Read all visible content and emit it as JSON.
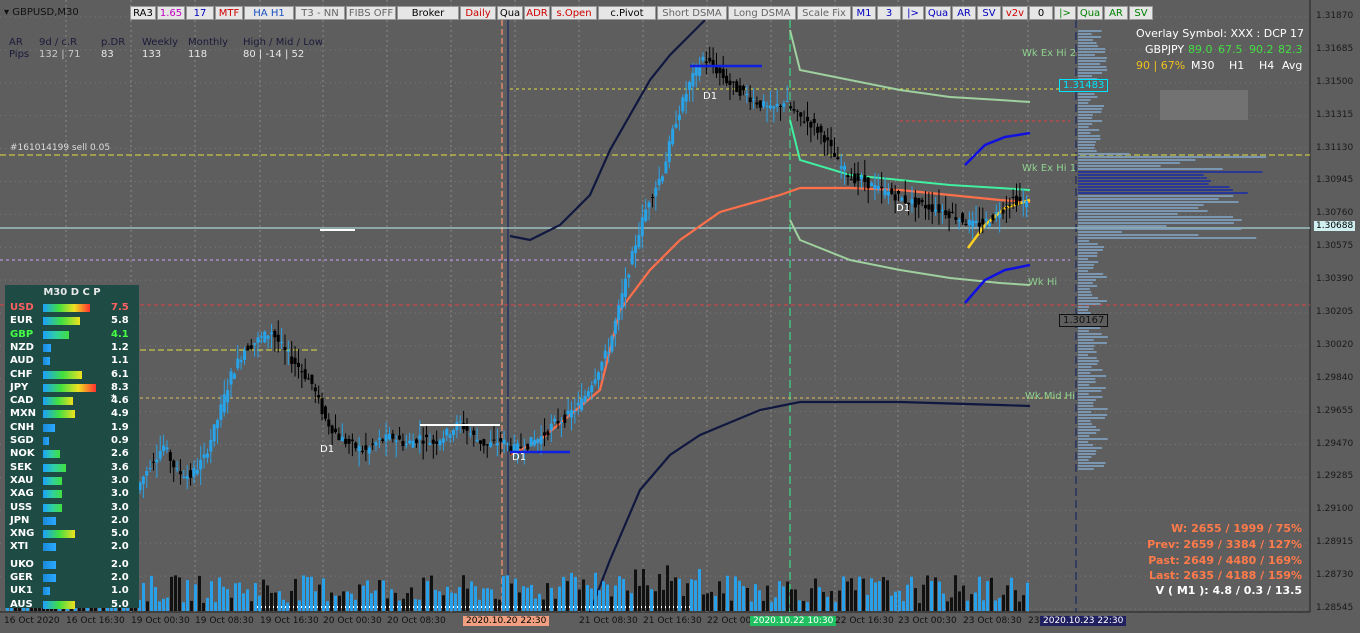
{
  "window": {
    "title": "GBPUSD,M30"
  },
  "toolbar": [
    {
      "label": "RA3",
      "color": "#000000"
    },
    {
      "label": "1.65",
      "color": "#c000c0"
    },
    {
      "label": "17",
      "color": "#0000c0"
    },
    {
      "label": "MTF",
      "color": "#d00000"
    },
    {
      "label": "HA H1",
      "color": "#1a50c0"
    },
    {
      "label": "T3 - NN",
      "color": "#666666"
    },
    {
      "label": "FIBS OFF",
      "color": "#666666"
    },
    {
      "label": "Broker",
      "color": "#000000"
    },
    {
      "label": "Daily",
      "color": "#d00000"
    },
    {
      "label": "Qua",
      "color": "#000000"
    },
    {
      "label": "ADR",
      "color": "#d00000"
    },
    {
      "label": "s.Open",
      "color": "#d00000"
    },
    {
      "label": "c.Pivot",
      "color": "#000000"
    },
    {
      "label": "Short DSMA",
      "color": "#666666"
    },
    {
      "label": "Long DSMA",
      "color": "#666666"
    },
    {
      "label": "Scale Fix",
      "color": "#666666"
    },
    {
      "label": "M1",
      "color": "#0000c0"
    },
    {
      "label": "3",
      "color": "#0000c0"
    },
    {
      "label": "|>",
      "color": "#0000c0"
    },
    {
      "label": "Qua",
      "color": "#0000c0"
    },
    {
      "label": "AR",
      "color": "#0000c0"
    },
    {
      "label": "SV",
      "color": "#0000c0"
    },
    {
      "label": "v2v",
      "color": "#d00000"
    },
    {
      "label": "0",
      "color": "#000000"
    },
    {
      "label": "|>",
      "color": "#008000"
    },
    {
      "label": "Qua",
      "color": "#008000"
    },
    {
      "label": "AR",
      "color": "#008000"
    },
    {
      "label": "SV",
      "color": "#008000"
    }
  ],
  "range_stats": {
    "headers": [
      "AR",
      "9d / c.R",
      "p.DR",
      "Weekly",
      "Monthly",
      "High / Mid / Low"
    ],
    "row_label": "Pips",
    "c_r_value": "132 | 71",
    "p_dr": "83",
    "weekly": "133",
    "monthly": "118",
    "hml": "80  |  -14  |  52"
  },
  "order_label": "#161014199 sell 0.05",
  "currency_panel": {
    "title": "M30   D C P",
    "rows": [
      {
        "name": "USD",
        "value": "7.5",
        "name_color": "#ff6060",
        "value_color": "#ff6060",
        "fill": 0.78,
        "bar": "redhot"
      },
      {
        "name": "EUR",
        "value": "5.8",
        "name_color": "#ffffff",
        "value_color": "#ffffff",
        "fill": 0.62,
        "bar": "warm"
      },
      {
        "name": "GBP",
        "value": "4.1",
        "name_color": "#44ff44",
        "value_color": "#44ff44",
        "fill": 0.44,
        "bar": "cool"
      },
      {
        "name": "NZD",
        "value": "1.2",
        "name_color": "#ffffff",
        "value_color": "#ffffff",
        "fill": 0.13,
        "bar": "blue"
      },
      {
        "name": "AUD",
        "value": "1.1",
        "name_color": "#ffffff",
        "value_color": "#ffffff",
        "fill": 0.12,
        "bar": "blue"
      },
      {
        "name": "CHF",
        "value": "6.1",
        "name_color": "#ffffff",
        "value_color": "#ffffff",
        "fill": 0.65,
        "bar": "warm"
      },
      {
        "name": "JPY",
        "value": "8.3 *",
        "name_color": "#ffffff",
        "value_color": "#ffffff",
        "fill": 0.88,
        "bar": "redhot"
      },
      {
        "name": "CAD",
        "value": "4.6",
        "name_color": "#ffffff",
        "value_color": "#ffffff",
        "fill": 0.5,
        "bar": "warm"
      },
      {
        "name": "MXN",
        "value": "4.9",
        "name_color": "#ffffff",
        "value_color": "#ffffff",
        "fill": 0.53,
        "bar": "warm"
      },
      {
        "name": "CNH",
        "value": "1.9",
        "name_color": "#ffffff",
        "value_color": "#ffffff",
        "fill": 0.2,
        "bar": "blue"
      },
      {
        "name": "SGD",
        "value": "0.9",
        "name_color": "#ffffff",
        "value_color": "#ffffff",
        "fill": 0.1,
        "bar": "blue"
      },
      {
        "name": "NOK",
        "value": "2.6",
        "name_color": "#ffffff",
        "value_color": "#ffffff",
        "fill": 0.28,
        "bar": "cool"
      },
      {
        "name": "SEK",
        "value": "3.6",
        "name_color": "#ffffff",
        "value_color": "#ffffff",
        "fill": 0.38,
        "bar": "cool"
      },
      {
        "name": "XAU",
        "value": "3.0",
        "name_color": "#ffffff",
        "value_color": "#ffffff",
        "fill": 0.32,
        "bar": "cool"
      },
      {
        "name": "XAG",
        "value": "3.0",
        "name_color": "#ffffff",
        "value_color": "#ffffff",
        "fill": 0.32,
        "bar": "cool"
      },
      {
        "name": "USS",
        "value": "3.0",
        "name_color": "#ffffff",
        "value_color": "#ffffff",
        "fill": 0.32,
        "bar": "cool"
      },
      {
        "name": "JPN",
        "value": "2.0",
        "name_color": "#ffffff",
        "value_color": "#ffffff",
        "fill": 0.21,
        "bar": "blue"
      },
      {
        "name": "XNG",
        "value": "5.0",
        "name_color": "#ffffff",
        "value_color": "#ffffff",
        "fill": 0.54,
        "bar": "warm"
      },
      {
        "name": "XTI",
        "value": "2.0",
        "name_color": "#ffffff",
        "value_color": "#ffffff",
        "fill": 0.21,
        "bar": "blue"
      },
      {
        "name": "UKO",
        "value": "2.0",
        "name_color": "#ffffff",
        "value_color": "#ffffff",
        "fill": 0.21,
        "bar": "blue"
      },
      {
        "name": "GER",
        "value": "2.0",
        "name_color": "#ffffff",
        "value_color": "#ffffff",
        "fill": 0.21,
        "bar": "blue"
      },
      {
        "name": "UK1",
        "value": "1.0",
        "name_color": "#ffffff",
        "value_color": "#ffffff",
        "fill": 0.11,
        "bar": "blue"
      },
      {
        "name": "AUS",
        "value": "5.0",
        "name_color": "#ffffff",
        "value_color": "#ffffff",
        "fill": 0.54,
        "bar": "warm"
      }
    ]
  },
  "overlay": {
    "title": "Overlay Symbol: XXX : DCP 17",
    "symbol": "GBPJPY",
    "values": [
      "89.0",
      "67.5",
      "90.2",
      "82.3"
    ],
    "value_colors": [
      "#44dd44",
      "#44dd44",
      "#44dd44",
      "#44dd44"
    ],
    "second_row": [
      "90 | 67%",
      "M30",
      "H1",
      "H4",
      "Avg"
    ]
  },
  "level_labels": {
    "wk_ex_hi_2": "Wk Ex Hi 2",
    "wk_ex_hi_1": "Wk Ex Hi 1",
    "wk_hi": "Wk Hi",
    "wk_mid_hi": "Wk Mid Hi",
    "d1_a": "D1",
    "d1_b": "D1",
    "d1_c": "D1",
    "d1_d": "D1"
  },
  "price_tags": {
    "top_tag": "1.31483",
    "mid_tag": "1.30167",
    "current": "1.30688"
  },
  "stats_bottom": {
    "w": "W: 2655 / 1999 / 75%",
    "prev": "Prev: 2659 / 3384 / 127%",
    "past": "Past: 2649 / 4480 / 169%",
    "last": "Last: 2635 / 4188 / 159%",
    "vol": "V ( M1 ): 4.8 / 0.3 / 13.5"
  },
  "colors": {
    "bull": "#29a3e8",
    "bear": "#000000",
    "background": "#5e5e5e",
    "accent_red": "#e0604a"
  },
  "chart_data": {
    "type": "candlestick",
    "symbol": "GBPUSD",
    "timeframe": "M30",
    "y_ticks": [
      "1.31870",
      "1.31685",
      "1.31500",
      "1.31315",
      "1.31130",
      "1.30945",
      "1.30760",
      "1.30575",
      "1.30390",
      "1.30205",
      "1.30020",
      "1.29840",
      "1.29655",
      "1.29470",
      "1.29285",
      "1.29100",
      "1.28915",
      "1.28730",
      "1.28545"
    ],
    "ylim": [
      1.2852,
      1.3192
    ],
    "x_ticks": [
      "16 Oct 2020",
      "16 Oct 16:30",
      "19 Oct 00:30",
      "19 Oct 08:30",
      "19 Oct 16:30",
      "20 Oct 00:30",
      "20 Oct 08:30",
      "2020.10.20 22:30",
      "21 Oct 08:30",
      "21 Oct 16:30",
      "22 Oct 00",
      "2020.10.22 10:30",
      "22 Oct 16:30",
      "23 Oct 00:30",
      "23 Oct 08:30",
      "23",
      "2020.10.23 22:30"
    ],
    "price_path": [
      1.292,
      1.2935,
      1.2945,
      1.293,
      1.2928,
      1.2938,
      1.296,
      1.2985,
      1.3,
      1.3005,
      1.301,
      1.2998,
      1.299,
      1.298,
      1.296,
      1.295,
      1.2945,
      1.2942,
      1.2948,
      1.295,
      1.2946,
      1.295,
      1.2947,
      1.2952,
      1.2958,
      1.295,
      1.2945,
      1.2948,
      1.2943,
      1.2946,
      1.295,
      1.2958,
      1.2962,
      1.297,
      1.2985,
      1.3,
      1.303,
      1.306,
      1.3085,
      1.31,
      1.313,
      1.315,
      1.3165,
      1.3158,
      1.315,
      1.3145,
      1.314,
      1.3135,
      1.314,
      1.3132,
      1.3128,
      1.312,
      1.3105,
      1.3097,
      1.3095,
      1.309,
      1.3088,
      1.3084,
      1.3082,
      1.308,
      1.3078,
      1.3074,
      1.307,
      1.3072,
      1.3078,
      1.3085,
      1.3082
    ]
  }
}
